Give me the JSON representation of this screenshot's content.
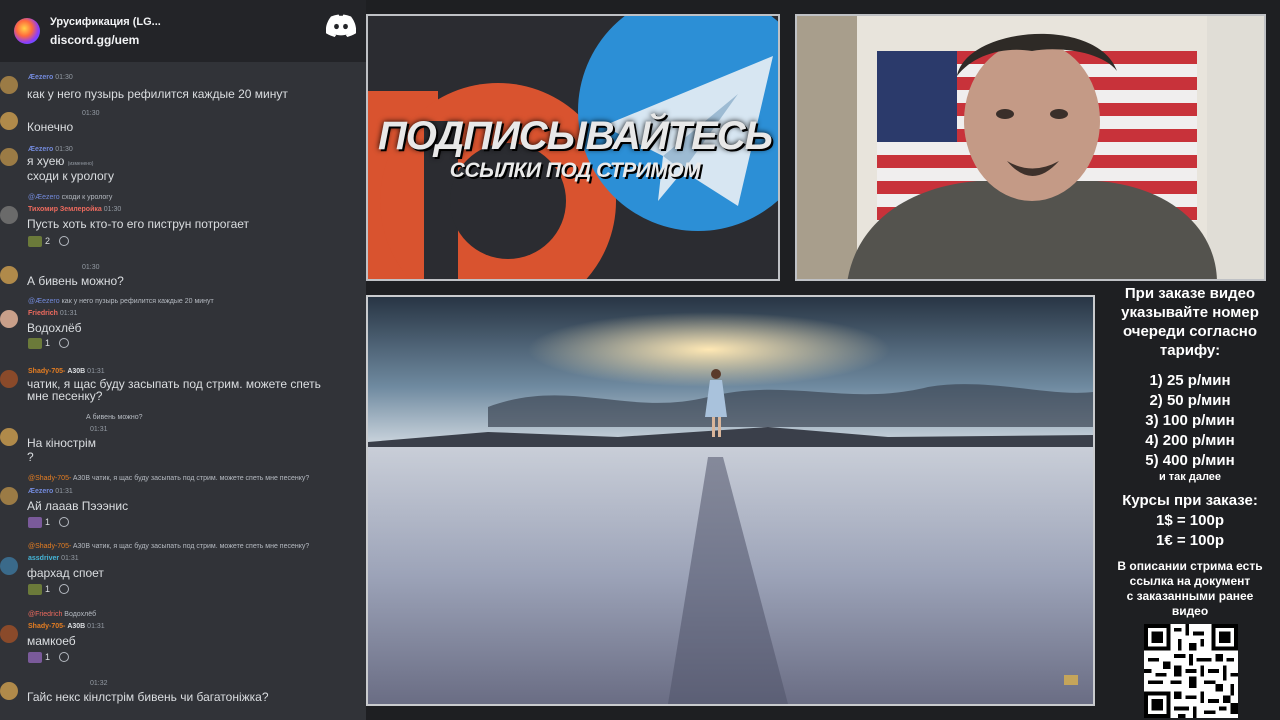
{
  "header": {
    "title": "Урусификация (LG...",
    "subtitle": "discord.gg/uem"
  },
  "messages": [
    {
      "name": "Æezero",
      "time": "01:30",
      "name_color": "#7289da",
      "text": "как у него пузырь рефилится каждые 20 минут",
      "reply": "",
      "reply_text": "",
      "reaction_count": ""
    },
    {
      "name": "",
      "time": "01:30",
      "name_color": "#58a35b",
      "text": "Конечно",
      "reply": "",
      "reply_text": "",
      "reaction_count": ""
    },
    {
      "name": "Æezero",
      "time": "01:30",
      "name_color": "#7289da",
      "text": "я хуею",
      "edited": "(изменено)",
      "text2": "сходи к урологу",
      "reply": "",
      "reply_text": "",
      "reaction_count": ""
    },
    {
      "name": "Тихомир Землеройка",
      "time": "01:30",
      "name_color": "#ed6a5e",
      "text": "Пусть хоть кто-то его пиструн потрогает",
      "reply": "@Æezero",
      "reply_text": "сходи к урологу",
      "reaction_count": "2"
    },
    {
      "name": "",
      "time": "01:30",
      "name_color": "#58a35b",
      "text": "А бивень можно?",
      "reply": "",
      "reply_text": "",
      "reaction_count": ""
    },
    {
      "name": "Friedrich",
      "time": "01:31",
      "name_color": "#ed6a5e",
      "text": "Водохлёб",
      "reply": "@Æezero",
      "reply_text": "как у него пузырь рефилится каждые 20 минут",
      "reaction_count": "1"
    },
    {
      "name": "Shady-705-",
      "tag": "A30B",
      "time": "01:31",
      "name_color": "#e67e22",
      "text": "чатик, я щас буду засыпать под стрим. можете спеть",
      "text2": "мне песенку?",
      "reply": "",
      "reply_text": "",
      "reaction_count": ""
    },
    {
      "name": "",
      "time": "01:31",
      "name_color": "#58a35b",
      "text": "На кінострім",
      "text2": "?",
      "reply": "",
      "reply_text": "А бивень можно?",
      "reaction_count": ""
    },
    {
      "name": "Æezero",
      "time": "01:31",
      "name_color": "#7289da",
      "text": "Ай лааав Пэээнис",
      "reply": "@Shady-705-",
      "tag": "A30B",
      "reply_text": "чатик, я щас буду засыпать под стрим. можете спеть мне песенку?",
      "reaction_count": "1"
    },
    {
      "name": "assdriver",
      "time": "01:31",
      "name_color": "#45b6d8",
      "text": "фархад споет",
      "reply": "@Shady-705-",
      "tag": "A30B",
      "reply_text": "чатик, я щас буду засыпать под стрим. можете спеть мне песенку?",
      "reaction_count": "1"
    },
    {
      "name": "Shady-705-",
      "tag": "A30B",
      "time": "01:31",
      "name_color": "#e67e22",
      "text": "мамкоеб",
      "reply": "@Friedrich",
      "reply_text": "Водохлёб",
      "reaction_count": "1"
    },
    {
      "name": "",
      "time": "01:32",
      "name_color": "#58a35b",
      "text": "Гайс некс кінлстрім бивень чи багатоніжка?",
      "reply": "",
      "reply_text": "",
      "reaction_count": ""
    }
  ],
  "promo": {
    "title": "ПОДПИСЫВАЙТЕСЬ",
    "subtitle": "ССЫЛКИ ПОД СТРИМОМ"
  },
  "info": {
    "heading": [
      "При заказе видео",
      "указывайте номер",
      "очереди согласно",
      "тарифу:"
    ],
    "tariffs": [
      "1) 25 р/мин",
      "2) 50 р/мин",
      "3) 100 р/мин",
      "4) 200 р/мин",
      "5) 400 р/мин"
    ],
    "etc": "и так далее",
    "rates_heading": "Курсы при заказе:",
    "rates": [
      "1$ = 100р",
      "1€ = 100р"
    ],
    "desc": [
      "В описании стрима есть",
      "ссылка на документ",
      "с заказанными ранее",
      "видео"
    ]
  }
}
